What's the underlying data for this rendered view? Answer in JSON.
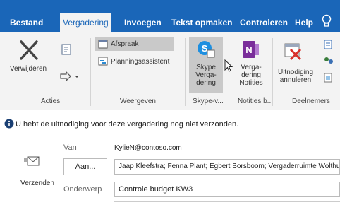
{
  "tabs": [
    {
      "label": "Bestand"
    },
    {
      "label": "Vergadering"
    },
    {
      "label": "Invoegen"
    },
    {
      "label": "Tekst opmaken"
    },
    {
      "label": "Controleren"
    },
    {
      "label": "Help"
    }
  ],
  "ribbon": {
    "delete_label": "Verwijderen",
    "actions_group": "Acties",
    "appointment_label": "Afspraak",
    "scheduling_label": "Planningsassistent",
    "view_group": "Weergeven",
    "skype_label": "Skype\nVerga-\ndering",
    "skype_group": "Skype-v...",
    "notes_label": "Verga-\ndering\nNotities",
    "notes_group": "Notities b...",
    "cancel_label": "Uitnodiging\nannuleren",
    "attendees_group": "Deelnemers"
  },
  "info_bar": "U hebt de uitnodiging voor deze vergadering nog niet verzonden.",
  "compose": {
    "send_label": "Verzenden",
    "from_label": "Van",
    "from_value": "KylieN@contoso.com",
    "to_button": "Aan...",
    "to_value": "Jaap Kleefstra; Fenna Plant; Egbert Borsboom; Vergaderruimte Wolthuis",
    "subject_label": "Onderwerp",
    "subject_value": "Controle budget KW3"
  },
  "colors": {
    "accent": "#1a66b8",
    "ribbon_bg": "#f3f3f3"
  }
}
